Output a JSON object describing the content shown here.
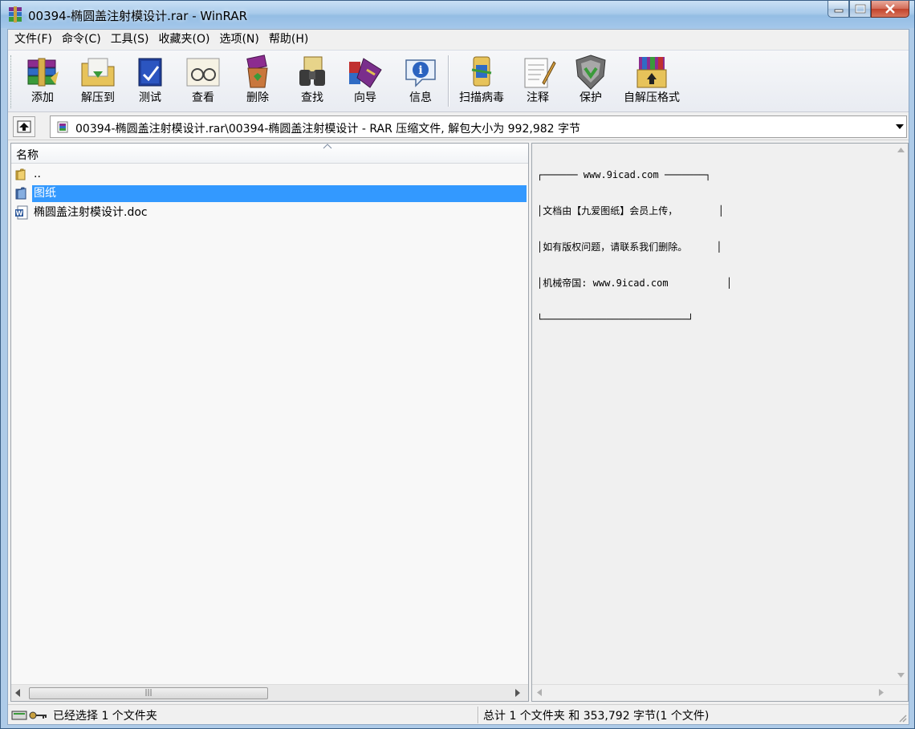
{
  "window": {
    "title": "00394-椭圆盖注射模设计.rar - WinRAR"
  },
  "menu": [
    "文件(F)",
    "命令(C)",
    "工具(S)",
    "收藏夹(O)",
    "选项(N)",
    "帮助(H)"
  ],
  "toolbar": {
    "add": "添加",
    "extract": "解压到",
    "test": "测试",
    "view": "查看",
    "delete": "删除",
    "find": "查找",
    "wizard": "向导",
    "info": "信息",
    "virusscan": "扫描病毒",
    "comment": "注释",
    "protect": "保护",
    "sfx": "自解压格式"
  },
  "address": {
    "path": "00394-椭圆盖注射模设计.rar\\00394-椭圆盖注射模设计 - RAR 压缩文件, 解包大小为 992,982 字节"
  },
  "filelist": {
    "column_name": "名称",
    "items": [
      {
        "label": "..",
        "type": "folder-up"
      },
      {
        "label": "图纸",
        "type": "folder"
      },
      {
        "label": "椭圆盖注射模设计.doc",
        "type": "doc"
      }
    ]
  },
  "comment": {
    "lines": [
      "┌────── www.9icad.com ───────┐",
      "│文档由【九爱图纸】会员上传，       │",
      "│如有版权问题，请联系我们删除。     │",
      "│机械帝国: www.9icad.com          │",
      "└─────────────────────────┘"
    ]
  },
  "status": {
    "left": "已经选择 1 个文件夹",
    "right": "总计 1 个文件夹 和 353,792 字节(1 个文件)"
  },
  "colors": {
    "selection": "#3399ff",
    "titlebar": "#a9cbeb"
  }
}
